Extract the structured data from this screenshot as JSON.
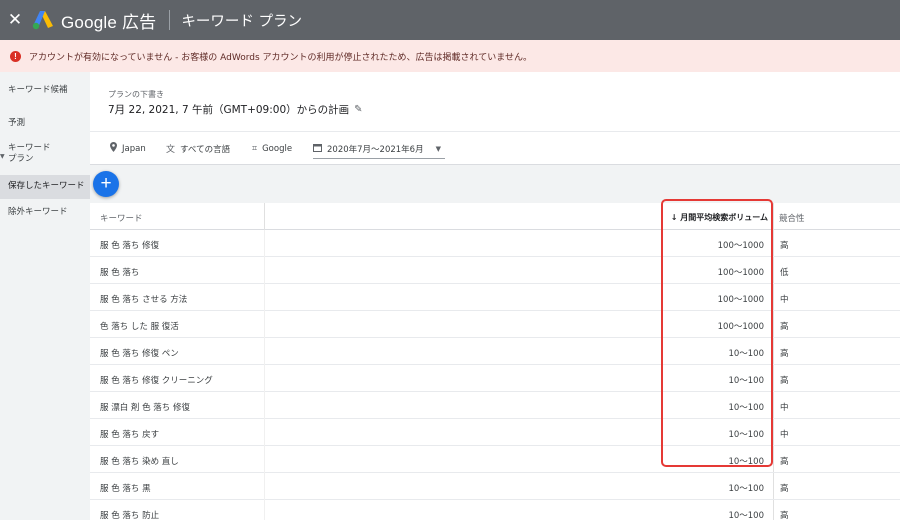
{
  "appbar": {
    "close_icon": "close-icon",
    "brand": "Google 広告",
    "title": "キーワード プラン"
  },
  "alert": {
    "icon": "!",
    "message": "アカウントが有効になっていません - お客様の AdWords アカウントの利用が停止されたため、広告は掲載されていません。"
  },
  "sidebar": {
    "items": [
      {
        "label": "キーワード候補"
      },
      {
        "label": "予測"
      },
      {
        "label": "キーワード\nプラン"
      },
      {
        "label": "保存したキーワード"
      },
      {
        "label": "除外キーワード"
      }
    ]
  },
  "plan": {
    "subtitle": "プランの下書き",
    "title": "7月 22, 2021, 7 午前（GMT+09:00）からの計画"
  },
  "filters": {
    "location": "Japan",
    "language": "すべての言語",
    "network": "Google",
    "date_range": "2020年7月～2021年6月"
  },
  "table": {
    "headers": {
      "keyword": "キーワード",
      "volume": "↓ 月間平均検索ボリューム",
      "competition": "競合性"
    },
    "rows": [
      {
        "keyword": "服 色 落ち 修復",
        "volume": "100～1000",
        "competition": "高"
      },
      {
        "keyword": "服 色 落ち",
        "volume": "100～1000",
        "competition": "低"
      },
      {
        "keyword": "服 色 落ち させる 方法",
        "volume": "100～1000",
        "competition": "中"
      },
      {
        "keyword": "色 落ち した 服 復活",
        "volume": "100～1000",
        "competition": "高"
      },
      {
        "keyword": "服 色 落ち 修復 ペン",
        "volume": "10～100",
        "competition": "高"
      },
      {
        "keyword": "服 色 落ち 修復 クリーニング",
        "volume": "10～100",
        "competition": "高"
      },
      {
        "keyword": "服 漂白 剤 色 落ち 修復",
        "volume": "10～100",
        "competition": "中"
      },
      {
        "keyword": "服 色 落ち 戻す",
        "volume": "10～100",
        "competition": "中"
      },
      {
        "keyword": "服 色 落ち 染め 直し",
        "volume": "10～100",
        "competition": "高"
      },
      {
        "keyword": "服 色 落ち 黒",
        "volume": "10～100",
        "competition": "高"
      },
      {
        "keyword": "服 色 落ち 防止",
        "volume": "10～100",
        "competition": "高"
      }
    ]
  },
  "colors": {
    "appbar": "#5f6368",
    "alert_bg": "#fce8e6",
    "accent": "#1a73e8",
    "highlight": "#e53935"
  }
}
